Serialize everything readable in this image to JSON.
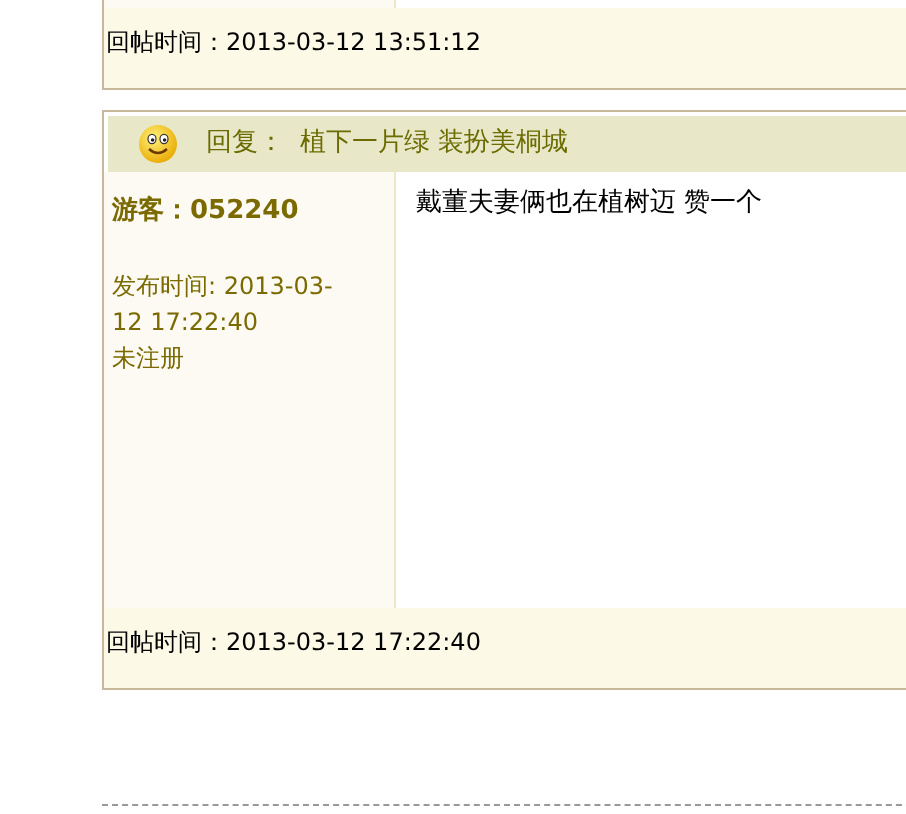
{
  "previous_post": {
    "reply_time": "回帖时间：2013-03-12 13:51:12"
  },
  "post": {
    "title_label": "回复：",
    "title": "植下一片绿 装扮美桐城",
    "author": "游客：052240",
    "published": "发布时间: 2013-03-12 17:22:40",
    "status": "未注册",
    "message": "戴董夫妻俩也在植树迈 赞一个",
    "reply_time": "回帖时间：2013-03-12 17:22:40"
  }
}
